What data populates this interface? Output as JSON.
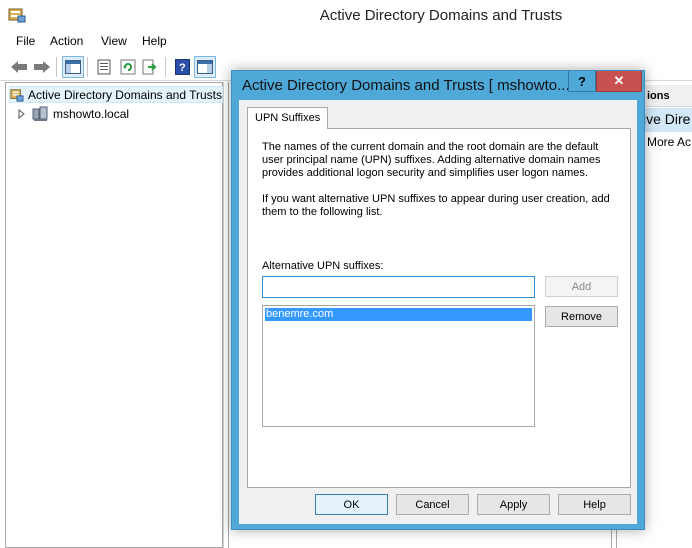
{
  "window": {
    "title": "Active Directory Domains and Trusts"
  },
  "menu": {
    "items": [
      "File",
      "Action",
      "View",
      "Help"
    ]
  },
  "tree": {
    "root_label": "Active Directory Domains and Trusts",
    "child_label": "mshowto.local"
  },
  "actions": {
    "header": "ions",
    "subheader": "ive Dire",
    "more": "More Ac"
  },
  "dialog": {
    "title": "Active Directory Domains and Trusts [ mshowto...",
    "help_glyph": "?",
    "close_glyph": "✕",
    "tab_label": "UPN Suffixes",
    "paragraph1": "The names of the current domain and the root domain are the default user principal name (UPN) suffixes. Adding alternative domain names provides additional logon security and simplifies user logon names.",
    "paragraph2": "If you want alternative UPN suffixes to appear during user creation, add them to the following list.",
    "alt_label": "Alternative UPN suffixes:",
    "input_value": "",
    "list_items": [
      "benemre.com"
    ],
    "add_label": "Add",
    "remove_label": "Remove",
    "ok_label": "OK",
    "cancel_label": "Cancel",
    "apply_label": "Apply",
    "help_label": "Help"
  },
  "colors": {
    "dialog_frame": "#4ea9d8",
    "close_button": "#c75050",
    "selection": "#3399ff"
  }
}
